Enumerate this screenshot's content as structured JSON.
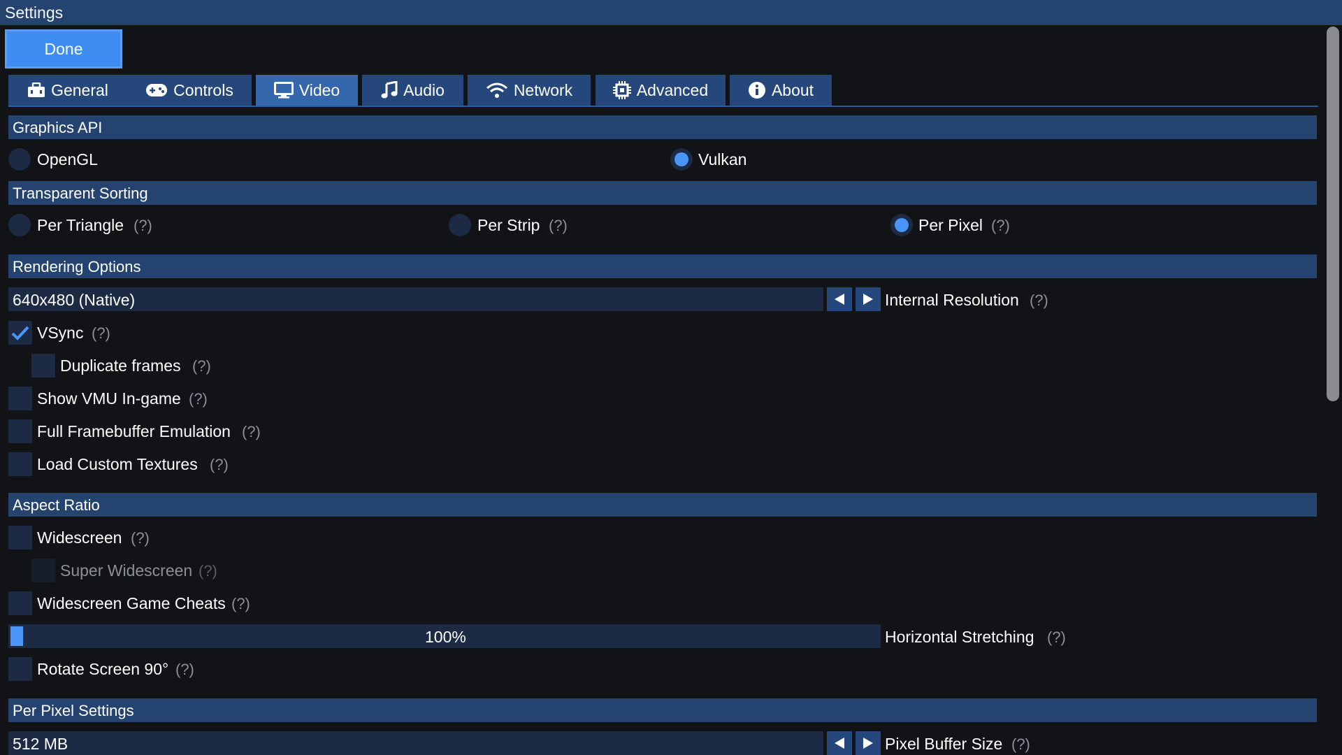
{
  "window": {
    "title": "Settings"
  },
  "done_label": "Done",
  "tabs": [
    {
      "label": "General",
      "icon": "toolbox-icon"
    },
    {
      "label": "Controls",
      "icon": "gamepad-icon"
    },
    {
      "label": "Video",
      "icon": "monitor-icon",
      "active": true
    },
    {
      "label": "Audio",
      "icon": "music-note-icon"
    },
    {
      "label": "Network",
      "icon": "wifi-icon"
    },
    {
      "label": "Advanced",
      "icon": "chip-icon"
    },
    {
      "label": "About",
      "icon": "info-icon"
    }
  ],
  "help_mark": "(?)",
  "graphics_api": {
    "title": "Graphics API",
    "options": [
      "OpenGL",
      "Vulkan"
    ],
    "selected": "Vulkan"
  },
  "transparent_sorting": {
    "title": "Transparent Sorting",
    "options": [
      "Per Triangle",
      "Per Strip",
      "Per Pixel"
    ],
    "selected": "Per Pixel"
  },
  "rendering": {
    "title": "Rendering Options",
    "internal_resolution": {
      "value": "640x480 (Native)",
      "label": "Internal Resolution"
    },
    "vsync": {
      "label": "VSync",
      "checked": true
    },
    "duplicate_frames": {
      "label": "Duplicate frames",
      "checked": false
    },
    "show_vmu": {
      "label": "Show VMU In-game",
      "checked": false
    },
    "full_framebuffer": {
      "label": "Full Framebuffer Emulation",
      "checked": false
    },
    "custom_textures": {
      "label": "Load Custom Textures",
      "checked": false
    }
  },
  "aspect": {
    "title": "Aspect Ratio",
    "widescreen": {
      "label": "Widescreen",
      "checked": false
    },
    "super_widescreen": {
      "label": "Super Widescreen",
      "checked": false,
      "disabled": true
    },
    "widescreen_cheats": {
      "label": "Widescreen Game Cheats",
      "checked": false
    },
    "horizontal_stretching": {
      "value_text": "100%",
      "label": "Horizontal Stretching",
      "fraction": 0.0
    },
    "rotate": {
      "label": "Rotate Screen 90°",
      "checked": false
    }
  },
  "per_pixel": {
    "title": "Per Pixel Settings",
    "pixel_buffer": {
      "value": "512 MB",
      "label": "Pixel Buffer Size"
    }
  },
  "colors": {
    "accent": "#4a96f8",
    "section_bg": "#24436f",
    "control_bg": "#1c2a44",
    "background": "#121316"
  }
}
